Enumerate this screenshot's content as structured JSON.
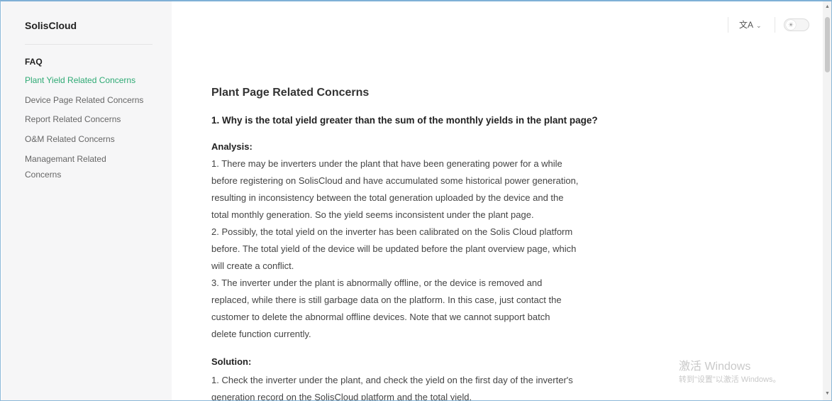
{
  "sidebar": {
    "brand": "SolisCloud",
    "heading": "FAQ",
    "items": [
      {
        "label": "Plant Yield Related Concerns",
        "active": true
      },
      {
        "label": "Device Page Related Concerns",
        "active": false
      },
      {
        "label": "Report Related Concerns",
        "active": false
      },
      {
        "label": "O&M Related Concerns",
        "active": false
      },
      {
        "label": "Managemant Related Concerns",
        "active": false
      }
    ]
  },
  "topbar": {
    "language_icon": "translate-icon",
    "language_glyph": "文A",
    "theme_icon": "sun-icon"
  },
  "main": {
    "title": "Plant Page Related Concerns",
    "question": "1. Why is the total yield greater than the sum of the monthly yields in the plant page?",
    "analysis_label": "Analysis:",
    "analysis_lines": [
      "1. There may be inverters under the plant that have been generating power for a while",
      "before registering on SolisCloud and have accumulated some historical power generation,",
      "resulting in inconsistency between the total generation uploaded by the device and the",
      "total monthly generation. So the yield seems inconsistent under the plant page.",
      "2. Possibly, the total yield on the inverter has been calibrated on the Solis Cloud platform",
      "before. The total yield of the device will be updated before the plant overview page, which",
      "will create a conflict.",
      "3. The inverter under the plant is abnormally offline, or the device is removed and",
      "replaced, while there is still garbage data on the platform. In this case, just contact the",
      "customer to delete the abnormal offline devices. Note that we cannot support batch",
      "delete function currently."
    ],
    "solution_label": "Solution:",
    "solution_lines": [
      "1. Check the inverter under the plant, and check the yield on the first day of the inverter's",
      "generation record on the SolisCloud platform and the total yield."
    ]
  },
  "watermark": {
    "line1": "激活 Windows",
    "line2": "转到\"设置\"以激活 Windows。"
  },
  "colors": {
    "accent": "#2eaa74",
    "sidebar_bg": "#f6f6f7"
  }
}
